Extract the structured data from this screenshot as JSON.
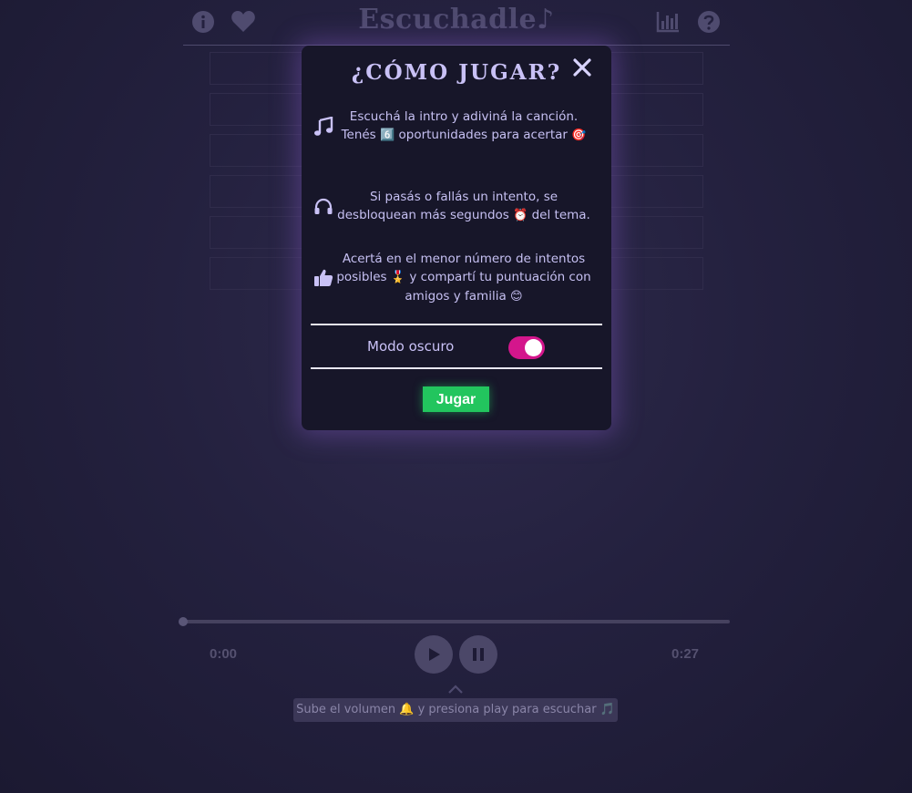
{
  "header": {
    "title": "Escuchadle♪"
  },
  "modal": {
    "title": "¿CÓMO JUGAR?",
    "close_symbol": "✕",
    "rules": [
      {
        "icon": "music-note-icon",
        "text_before": "Escuchá la intro y adiviná la canción. Tenés ",
        "emoji": "6️⃣",
        "text_middle": " oportunidades para acertar ",
        "emoji2": "🎯"
      },
      {
        "icon": "headphones-icon",
        "text_before": "Si pasás o fallás un intento, se desbloquean más segundos ",
        "emoji": "⏰",
        "text_middle": " del tema."
      },
      {
        "icon": "thumbs-up-icon",
        "text_before": "Acertá en el menor número de intentos posibles ",
        "emoji": "🎖️",
        "text_middle": " y compartí tu puntuación con amigos y familia ",
        "emoji2": "😊"
      }
    ],
    "dark_mode_label": "Modo oscuro",
    "dark_mode_enabled": true,
    "play_label": "Jugar"
  },
  "player": {
    "time_current": "0:00",
    "time_total": "0:27",
    "progress": 0,
    "hint_text": "Sube el volumen 🔔 y presiona play para escuchar 🎵"
  },
  "colors": {
    "accent_toggle": "#d4168c",
    "play_button": "#22c55e",
    "modal_bg": "#171629",
    "text": "#c9c1f6"
  }
}
